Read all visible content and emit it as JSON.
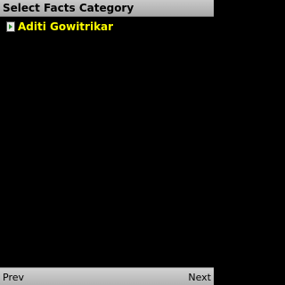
{
  "title_bar": {
    "title": "Select Facts Category"
  },
  "list": {
    "items": [
      {
        "label": "Aditi Gowitrikar",
        "icon": "document-icon",
        "color": "#ffff00"
      }
    ]
  },
  "softkeys": {
    "left": "Prev",
    "right": "Next"
  },
  "colors": {
    "background": "#000000",
    "item_text": "#ffff00",
    "bar": "#bdbdbd"
  }
}
